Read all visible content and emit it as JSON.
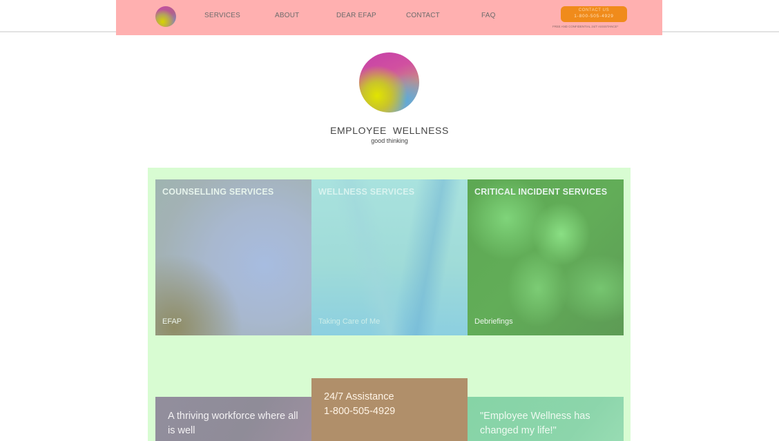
{
  "nav": {
    "items": [
      {
        "label": "SERVICES"
      },
      {
        "label": "ABOUT"
      },
      {
        "label": "DEAR EFAP"
      },
      {
        "label": "CONTACT"
      },
      {
        "label": "FAQ"
      }
    ],
    "cta": {
      "line1": "CONTACT US",
      "line2": "1-800-505-4929",
      "note": "FREE AND CONFIDENTIAL 24/7 ASSISTANCE*"
    }
  },
  "brand": {
    "title": "EMPLOYEE  WELLNESS",
    "subtitle": "good thinking"
  },
  "services": [
    {
      "title": "COUNSELLING SERVICES",
      "subtitle": "EFAP"
    },
    {
      "title": "WELLNESS SERVICES",
      "subtitle": "Taking Care of Me"
    },
    {
      "title": "CRITICAL INCIDENT SERVICES",
      "subtitle": "Debriefings"
    }
  ],
  "lower": {
    "left": {
      "line1": "A thriving workforce where all",
      "line2": "is well"
    },
    "center": {
      "line1": "24/7 Assistance",
      "line2": "1-800-505-4929"
    },
    "right": {
      "line1": "\"Employee Wellness has",
      "line2": "changed my life!\""
    }
  },
  "colors": {
    "nav_bg": "#ffb0b0",
    "cta_bg": "#f08b1b",
    "services_bg": "#d8fcd2"
  }
}
